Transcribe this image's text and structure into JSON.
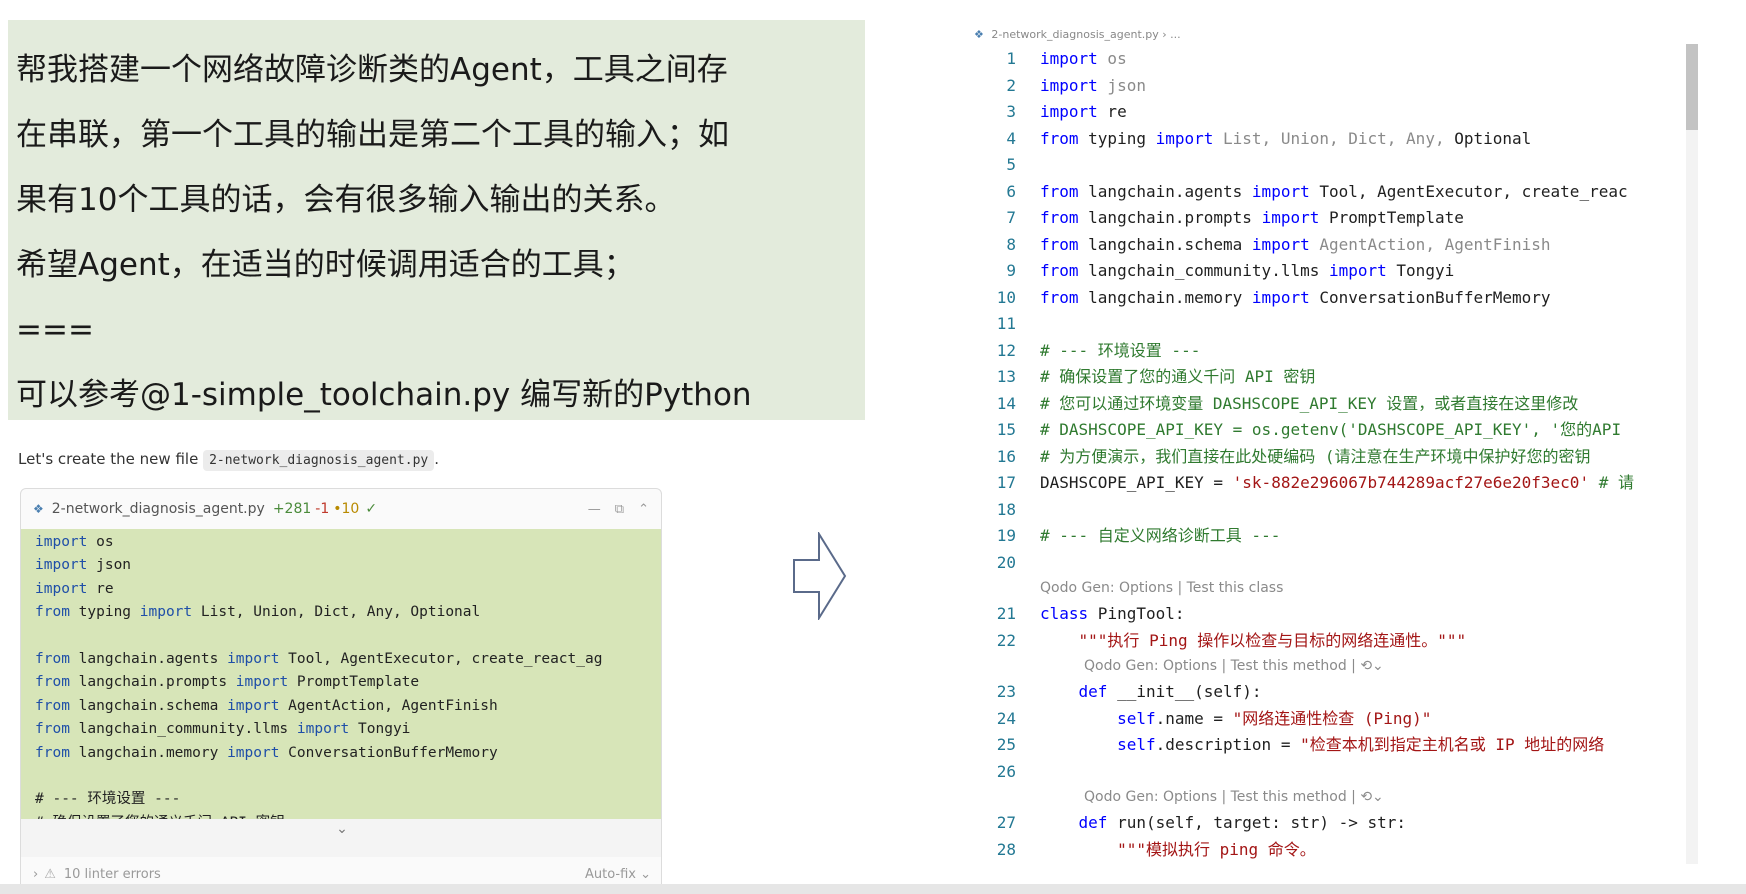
{
  "prompt": {
    "lines": [
      "帮我搭建一个网络故障诊断类的Agent，工具之间存",
      "在串联，第一个工具的输出是第二个工具的输入；如",
      "果有10个工具的话，会有很多输入输出的关系。",
      "希望Agent，在适当的时候调用适合的工具；",
      "===",
      "可以参考@1-simple_toolchain.py 编写新的Python"
    ]
  },
  "chat": {
    "intro": "Let's create the new file",
    "file_chip": "2-network_diagnosis_agent.py",
    "intro_end": "."
  },
  "diff_card": {
    "filename": "2-network_diagnosis_agent.py",
    "added": "+281",
    "removed": "-1",
    "changed": "•10",
    "check": "✓",
    "collapse_icon": "—",
    "copy_icon": "⧉",
    "expand_icon": "⌃",
    "code_lines": [
      {
        "parts": [
          {
            "t": "import",
            "k": "kw"
          },
          {
            "t": " os"
          }
        ]
      },
      {
        "parts": [
          {
            "t": "import",
            "k": "kw"
          },
          {
            "t": " json"
          }
        ]
      },
      {
        "parts": [
          {
            "t": "import",
            "k": "kw"
          },
          {
            "t": " re"
          }
        ]
      },
      {
        "parts": [
          {
            "t": "from",
            "k": "kw"
          },
          {
            "t": " typing "
          },
          {
            "t": "import",
            "k": "kw"
          },
          {
            "t": " List, Union, Dict, Any, Optional"
          }
        ]
      },
      {
        "parts": [
          {
            "t": ""
          }
        ]
      },
      {
        "parts": [
          {
            "t": "from",
            "k": "kw"
          },
          {
            "t": " langchain.agents "
          },
          {
            "t": "import",
            "k": "kw"
          },
          {
            "t": " Tool, AgentExecutor, create_react_ag"
          }
        ]
      },
      {
        "parts": [
          {
            "t": "from",
            "k": "kw"
          },
          {
            "t": " langchain.prompts "
          },
          {
            "t": "import",
            "k": "kw"
          },
          {
            "t": " PromptTemplate"
          }
        ]
      },
      {
        "parts": [
          {
            "t": "from",
            "k": "kw"
          },
          {
            "t": " langchain.schema "
          },
          {
            "t": "import",
            "k": "kw"
          },
          {
            "t": " AgentAction, AgentFinish"
          }
        ]
      },
      {
        "parts": [
          {
            "t": "from",
            "k": "kw"
          },
          {
            "t": " langchain_community.llms "
          },
          {
            "t": "import",
            "k": "kw"
          },
          {
            "t": " Tongyi"
          }
        ]
      },
      {
        "parts": [
          {
            "t": "from",
            "k": "kw"
          },
          {
            "t": " langchain.memory "
          },
          {
            "t": "import",
            "k": "kw"
          },
          {
            "t": " ConversationBufferMemory"
          }
        ]
      },
      {
        "parts": [
          {
            "t": ""
          }
        ]
      },
      {
        "parts": [
          {
            "t": "# --- 环境设置 ---"
          }
        ]
      },
      {
        "parts": [
          {
            "t": "# 确保设置了您的通义千问 API 密钥"
          }
        ]
      }
    ],
    "expand_chevron": "⌄",
    "footer_chevron": "›",
    "linter_errors": "10 linter errors",
    "auto_fix": "Auto-fix ⌄"
  },
  "editor": {
    "breadcrumb": "2-network_diagnosis_agent.py",
    "breadcrumb_sep": "› ...",
    "lens_class": "Qodo Gen: Options | Test this class",
    "lens_method": "Qodo Gen: Options | Test this method | ⟲⌄",
    "lines": [
      {
        "n": "1",
        "parts": [
          {
            "t": "import",
            "k": "kw"
          },
          {
            "t": " os",
            "k": "dim"
          }
        ]
      },
      {
        "n": "2",
        "parts": [
          {
            "t": "import",
            "k": "kw"
          },
          {
            "t": " json",
            "k": "dim"
          }
        ]
      },
      {
        "n": "3",
        "parts": [
          {
            "t": "import",
            "k": "kw"
          },
          {
            "t": " re"
          }
        ]
      },
      {
        "n": "4",
        "parts": [
          {
            "t": "from",
            "k": "kw"
          },
          {
            "t": " typing "
          },
          {
            "t": "import",
            "k": "kw"
          },
          {
            "t": " List, Union, Dict, Any,",
            "k": "dim"
          },
          {
            "t": " Optional"
          }
        ]
      },
      {
        "n": "5",
        "parts": [
          {
            "t": ""
          }
        ]
      },
      {
        "n": "6",
        "parts": [
          {
            "t": "from",
            "k": "kw"
          },
          {
            "t": " langchain.agents "
          },
          {
            "t": "import",
            "k": "kw"
          },
          {
            "t": " Tool, AgentExecutor, create_reac"
          }
        ]
      },
      {
        "n": "7",
        "parts": [
          {
            "t": "from",
            "k": "kw"
          },
          {
            "t": " langchain.prompts "
          },
          {
            "t": "import",
            "k": "kw"
          },
          {
            "t": " PromptTemplate"
          }
        ]
      },
      {
        "n": "8",
        "parts": [
          {
            "t": "from",
            "k": "kw"
          },
          {
            "t": " langchain.schema "
          },
          {
            "t": "import",
            "k": "kw"
          },
          {
            "t": " AgentAction, AgentFinish",
            "k": "dim"
          }
        ]
      },
      {
        "n": "9",
        "parts": [
          {
            "t": "from",
            "k": "kw"
          },
          {
            "t": " langchain_community.llms "
          },
          {
            "t": "import",
            "k": "kw"
          },
          {
            "t": " Tongyi"
          }
        ]
      },
      {
        "n": "10",
        "parts": [
          {
            "t": "from",
            "k": "kw"
          },
          {
            "t": " langchain.memory "
          },
          {
            "t": "import",
            "k": "kw"
          },
          {
            "t": " ConversationBufferMemory"
          }
        ]
      },
      {
        "n": "11",
        "parts": [
          {
            "t": ""
          }
        ]
      },
      {
        "n": "12",
        "parts": [
          {
            "t": "# --- 环境设置 ---",
            "k": "cm"
          }
        ]
      },
      {
        "n": "13",
        "parts": [
          {
            "t": "# 确保设置了您的通义千问 API 密钥",
            "k": "cm"
          }
        ]
      },
      {
        "n": "14",
        "parts": [
          {
            "t": "# 您可以通过环境变量 DASHSCOPE_API_KEY 设置，或者直接在这里修改",
            "k": "cm"
          }
        ]
      },
      {
        "n": "15",
        "parts": [
          {
            "t": "# DASHSCOPE_API_KEY = os.getenv('DASHSCOPE_API_KEY', '您的API",
            "k": "cm"
          }
        ]
      },
      {
        "n": "16",
        "parts": [
          {
            "t": "# 为方便演示，我们直接在此处硬编码 (请注意在生产环境中保护好您的密钥",
            "k": "cm"
          }
        ]
      },
      {
        "n": "17",
        "parts": [
          {
            "t": "DASHSCOPE_API_KEY = "
          },
          {
            "t": "'sk-882e296067b744289acf27e6e20f3ec0'",
            "k": "str"
          },
          {
            "t": " # 请",
            "k": "cm"
          }
        ]
      },
      {
        "n": "18",
        "parts": [
          {
            "t": ""
          }
        ]
      },
      {
        "n": "19",
        "parts": [
          {
            "t": "# --- 自定义网络诊断工具 ---",
            "k": "cm"
          }
        ]
      },
      {
        "n": "20",
        "parts": [
          {
            "t": ""
          }
        ]
      },
      {
        "lens": "class"
      },
      {
        "n": "21",
        "parts": [
          {
            "t": "class",
            "k": "kw"
          },
          {
            "t": " PingTool:"
          }
        ]
      },
      {
        "n": "22",
        "parts": [
          {
            "t": "    "
          },
          {
            "t": "\"\"\"执行 Ping 操作以检查与目标的网络连通性。\"\"\"",
            "k": "str"
          }
        ]
      },
      {
        "lens": "method"
      },
      {
        "n": "23",
        "parts": [
          {
            "t": "    "
          },
          {
            "t": "def",
            "k": "kw"
          },
          {
            "t": " __init__(self):"
          }
        ]
      },
      {
        "n": "24",
        "parts": [
          {
            "t": "        "
          },
          {
            "t": "self",
            "k": "kw"
          },
          {
            "t": ".name = "
          },
          {
            "t": "\"网络连通性检查 (Ping)\"",
            "k": "str"
          }
        ]
      },
      {
        "n": "25",
        "parts": [
          {
            "t": "        "
          },
          {
            "t": "self",
            "k": "kw"
          },
          {
            "t": ".description = "
          },
          {
            "t": "\"检查本机到指定主机名或 IP 地址的网络",
            "k": "str"
          }
        ]
      },
      {
        "n": "26",
        "parts": [
          {
            "t": ""
          }
        ]
      },
      {
        "lens": "method"
      },
      {
        "n": "27",
        "parts": [
          {
            "t": "    "
          },
          {
            "t": "def",
            "k": "kw"
          },
          {
            "t": " run(self, target: str) -> str:"
          }
        ]
      },
      {
        "n": "28",
        "parts": [
          {
            "t": "        "
          },
          {
            "t": "\"\"\"模拟执行 ping 命令。",
            "k": "str"
          }
        ]
      }
    ]
  },
  "colors": {
    "prompt_bg": "#e3ebdc",
    "diff_added_bg": "#d7e5b8",
    "keyword": "#0000ff",
    "comment": "#2f7a2f",
    "string": "#a31515",
    "line_number": "#237893"
  },
  "icons": {
    "file": "python-file-icon",
    "arrow": "right-arrow-icon",
    "warning": "warning-triangle-icon"
  }
}
